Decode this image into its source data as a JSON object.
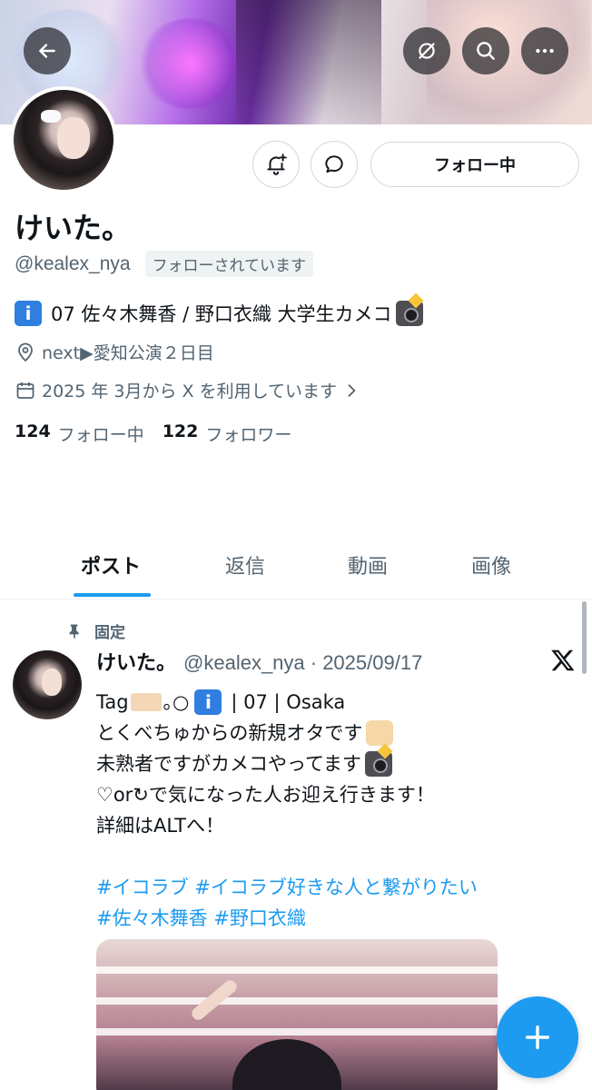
{
  "profile": {
    "name": "けいた。",
    "handle": "@kealex_nya",
    "follows_you": "フォローされています",
    "bio": "07 佐々木舞香 / 野口衣織 大学生カメコ",
    "location": "next▶愛知公演２日目",
    "joined": "2025 年 3月から X を利用しています",
    "following_count": "124",
    "following_label": "フォロー中",
    "followers_count": "122",
    "followers_label": "フォロワー"
  },
  "actions": {
    "follow_button": "フォロー中"
  },
  "tabs": [
    {
      "label": "ポスト",
      "active": true
    },
    {
      "label": "返信",
      "active": false
    },
    {
      "label": "動画",
      "active": false
    },
    {
      "label": "画像",
      "active": false
    }
  ],
  "post": {
    "pinned_label": "固定",
    "author_name": "けいた。",
    "author_meta": "@kealex_nya · 2025/09/17",
    "line1_prefix": "Tag",
    "line1_mid": "｡○",
    "line1_suffix": "| 07 | Osaka",
    "line2": "とくべちゅからの新規オタです",
    "line3": "未熟者ですがカメコやってます",
    "line4": "♡or↻で気になった人お迎え行きます！",
    "line5": "詳細はALTへ！",
    "hashtags_line1": "#イコラブ #イコラブ好きな人と繋がりたい",
    "hashtags_line2": "#佐々木舞香 #野口衣織"
  },
  "colors": {
    "accent": "#1d9bf0",
    "text_primary": "#0f1419",
    "text_secondary": "#536471"
  },
  "icons": [
    "back-arrow-icon",
    "grok-icon",
    "search-icon",
    "more-icon",
    "notify-bell-icon",
    "message-icon",
    "location-pin-icon",
    "calendar-icon",
    "chevron-right-icon",
    "pin-icon",
    "x-logo-icon",
    "plus-icon",
    "info-emoji-icon",
    "camera-flash-emoji-icon",
    "raised-hands-emoji-icon",
    "tag-emoji-icon"
  ]
}
